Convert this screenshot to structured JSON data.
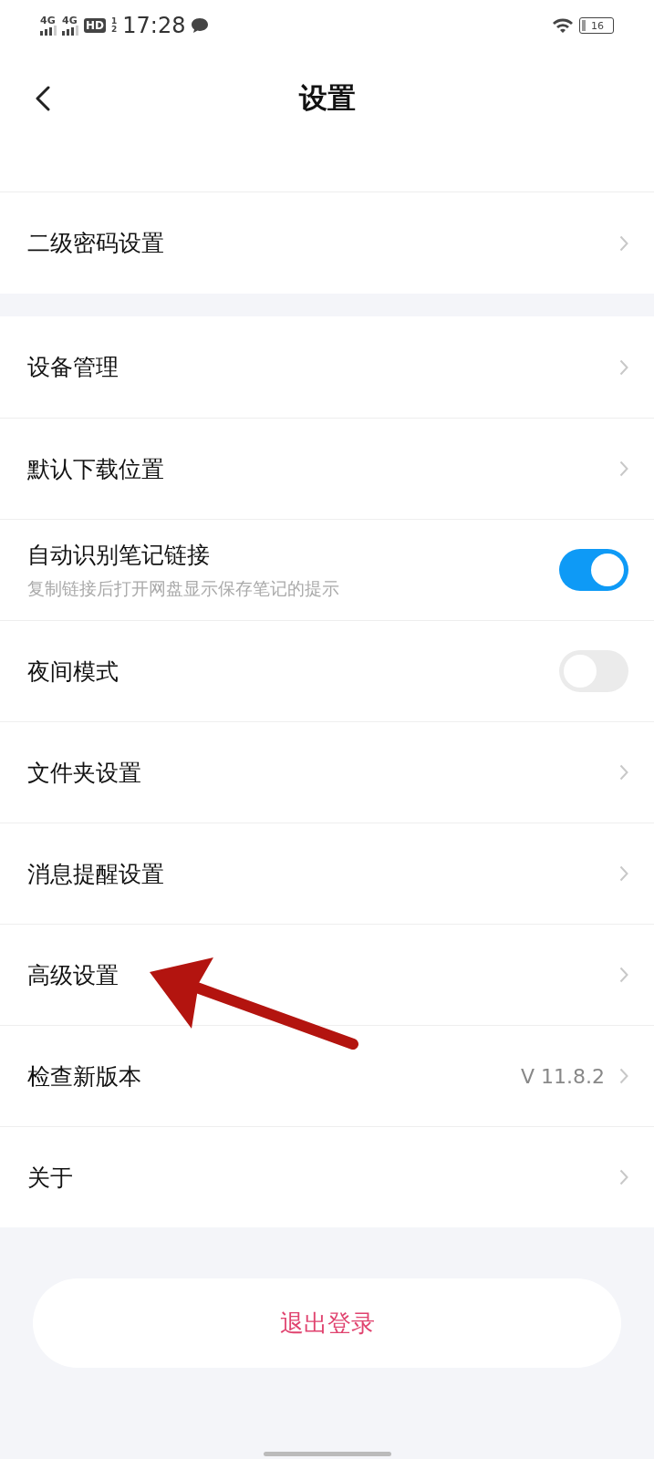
{
  "status_bar": {
    "network_1": "4G",
    "network_2": "4G",
    "hd": "HD",
    "hd_sup": "1",
    "hd_sub": "2",
    "time": "17:28",
    "battery": "16"
  },
  "header": {
    "title": "设置"
  },
  "sections": [
    {
      "items": [
        {
          "kind": "link",
          "label": "二级密码设置"
        }
      ]
    },
    {
      "items": [
        {
          "kind": "link",
          "label": "设备管理"
        },
        {
          "kind": "link",
          "label": "默认下载位置"
        },
        {
          "kind": "toggle",
          "label": "自动识别笔记链接",
          "subtitle": "复制链接后打开网盘显示保存笔记的提示",
          "on": true
        },
        {
          "kind": "toggle",
          "label": "夜间模式",
          "on": false
        },
        {
          "kind": "link",
          "label": "文件夹设置"
        },
        {
          "kind": "link",
          "label": "消息提醒设置"
        },
        {
          "kind": "link",
          "label": "高级设置"
        },
        {
          "kind": "link",
          "label": "检查新版本",
          "value": "V 11.8.2"
        },
        {
          "kind": "link",
          "label": "关于"
        }
      ]
    }
  ],
  "logout_button": "退出登录"
}
